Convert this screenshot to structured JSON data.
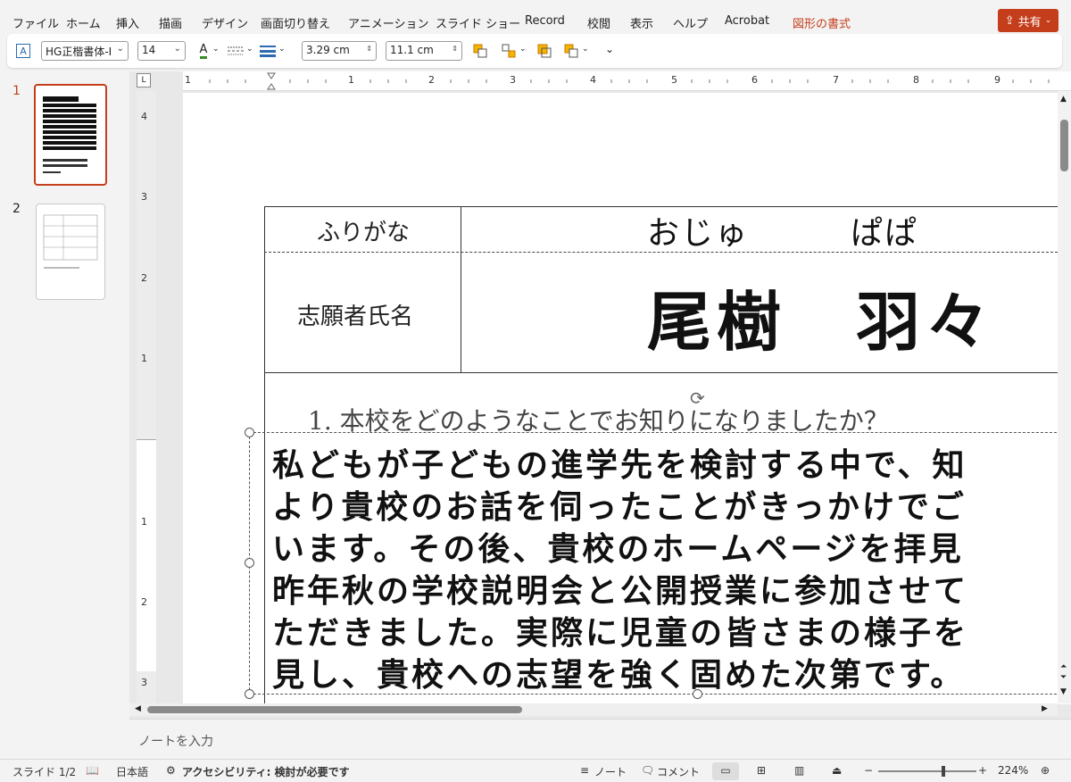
{
  "menu": {
    "items": [
      "ファイル",
      "ホーム",
      "挿入",
      "描画",
      "デザイン",
      "画面切り替え",
      "アニメーション",
      "スライド ショー",
      "Record",
      "校閲",
      "表示",
      "ヘルプ",
      "Acrobat",
      "図形の書式"
    ],
    "share_label": "共有"
  },
  "toolbar": {
    "font_name": "HG正楷書体-I",
    "font_size": "14",
    "font_color_letter": "A",
    "height_value": "3.29 cm",
    "width_value": "11.1 cm"
  },
  "slides_panel": {
    "slide_numbers": [
      "1",
      "2"
    ]
  },
  "ruler": {
    "h_ticks": [
      "1",
      "1",
      "2",
      "3",
      "4",
      "5",
      "6",
      "7",
      "8",
      "9"
    ],
    "v_ticks": [
      "4",
      "3",
      "2",
      "1",
      "1",
      "2",
      "3"
    ]
  },
  "slide": {
    "furigana_label": "ふりがな",
    "furigana_value": "おじゅ　　　ぱぱ",
    "name_label": "志願者氏名",
    "name_value": "尾樹　羽々",
    "question": "1. 本校をどのようなことでお知りになりましたか？",
    "answer_lines": [
      "私どもが子どもの進学先を検討する中で、知",
      "より貴校のお話を伺ったことがきっかけでご",
      "います。その後、貴校のホームページを拝見",
      "昨年秋の学校説明会と公開授業に参加させて",
      "ただきました。実際に児童の皆さまの様子を",
      "見し、貴校への志望を強く固めた次第です。"
    ]
  },
  "notes": {
    "placeholder": "ノートを入力"
  },
  "status": {
    "slide_info": "スライド 1/2",
    "language": "日本語",
    "accessibility": "アクセシビリティ: 検討が必要です",
    "notes_label": "ノート",
    "comments_label": "コメント",
    "zoom": "224%"
  },
  "colors": {
    "accent": "#c43e1c"
  }
}
